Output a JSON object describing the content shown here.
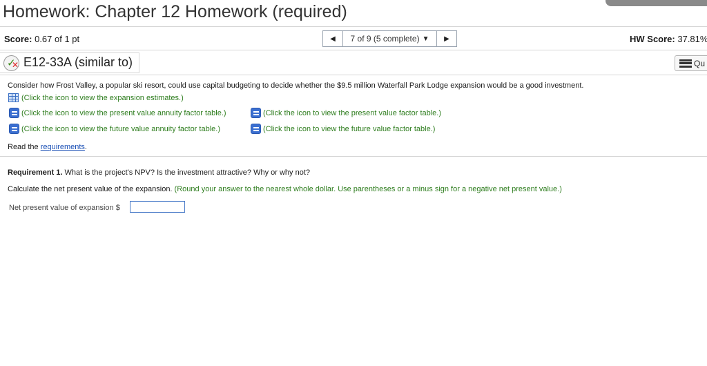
{
  "page_title": "Homework: Chapter 12 Homework (required)",
  "score": {
    "label": "Score:",
    "value": "0.67 of 1 pt"
  },
  "navigator": {
    "text": "7 of 9 (5 complete)",
    "prev_icon": "triangle-left-icon",
    "next_icon": "triangle-right-icon"
  },
  "hw_score": {
    "label": "HW Score:",
    "value": "37.81%"
  },
  "question": {
    "id": "E12-33A (similar to)",
    "status_icon": "partially-correct-icon"
  },
  "question_menu_label": "Qu",
  "intro": "Consider how Frost Valley, a popular ski resort, could use capital budgeting to decide whether the $9.5 million Waterfall Park Lodge expansion would be a good investment.",
  "links": {
    "expansion_estimates": "(Click the icon to view the expansion estimates.)",
    "pv_annuity": "(Click the icon to view the present value annuity factor table.)",
    "pv_factor": "(Click the icon to view the present value factor table.)",
    "fv_annuity": "(Click the icon to view the future value annuity factor table.)",
    "fv_factor": "(Click the icon to view the future value factor table.)"
  },
  "read_requirements": {
    "prefix": "Read the ",
    "link": "requirements",
    "suffix": "."
  },
  "requirement": {
    "label": "Requirement 1.",
    "question": " What is the project's NPV? Is the investment attractive? Why or why not?"
  },
  "instruction": {
    "main": "Calculate the net present value of the expansion.",
    "hint": " (Round your answer to the nearest whole dollar. Use parentheses or a minus sign for a negative net present value.)"
  },
  "answer": {
    "label": "Net present value of expansion $",
    "value": ""
  }
}
